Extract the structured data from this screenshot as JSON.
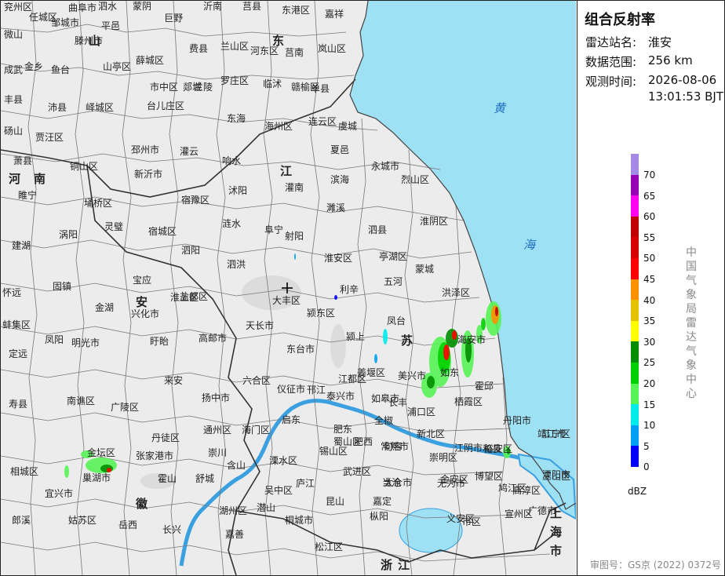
{
  "panel": {
    "title": "组合反射率",
    "station_label": "雷达站名:",
    "station_value": "淮安",
    "range_label": "数据范围:",
    "range_value": "256 km",
    "time_label": "观测时间:",
    "time_value_date": "2026-08-06",
    "time_value_time": "13:01:53 BJT",
    "unit": "dBZ",
    "agency": "中国气象局雷达气象中心",
    "approval": "审图号：GS京 (2022) 0372号"
  },
  "legend": {
    "ticks": [
      "70",
      "65",
      "60",
      "55",
      "50",
      "45",
      "40",
      "35",
      "30",
      "25",
      "20",
      "15",
      "10",
      "5",
      "0"
    ],
    "colors": [
      "#a48ae6",
      "#9500b4",
      "#ff00f0",
      "#c00000",
      "#d60000",
      "#ff0000",
      "#ff9000",
      "#e7c000",
      "#ffff00",
      "#008e00",
      "#00d000",
      "#56f456",
      "#00ecec",
      "#00a0f6",
      "#0000f6"
    ]
  },
  "map": {
    "colors": {
      "sea": "#9ee0f4",
      "land": "#ececec",
      "border": "#555555",
      "river": "#3aa0e0"
    },
    "provinces": [
      "山",
      "东",
      "河",
      "南",
      "安",
      "徽",
      "江",
      "苏",
      "浙",
      "江",
      "上",
      "海",
      "市"
    ],
    "seas": [
      "黄",
      "海"
    ],
    "places": [
      "兖州区",
      "曲阜市",
      "泗水",
      "蒙阴",
      "沂南",
      "莒县",
      "东港区",
      "嘉祥",
      "任城区",
      "邹城市",
      "平邑",
      "巨野",
      "微山",
      "滕州市",
      "费县",
      "兰山区",
      "河东区",
      "莒南",
      "岚山区",
      "成武",
      "金乡",
      "鱼台",
      "山亭区",
      "薛城区",
      "市中区",
      "兰陵",
      "罗庄区",
      "临沭",
      "赣榆区",
      "单县",
      "丰县",
      "沛县",
      "峄城区",
      "台儿庄区",
      "郯城",
      "东海",
      "海州区",
      "连云区",
      "虞城",
      "砀山",
      "贾汪区",
      "邳州市",
      "灌云",
      "夏邑",
      "萧县",
      "铜山区",
      "新沂市",
      "响水",
      "永城市",
      "睢宁",
      "宿豫区",
      "沭阳",
      "灌南",
      "滨海",
      "烈山区",
      "埇桥区",
      "灵璧",
      "宿城区",
      "泗阳",
      "涟水",
      "阜宁",
      "射阳",
      "濉溪",
      "泗县",
      "淮阴区",
      "建湖",
      "涡阳",
      "泗洪",
      "淮安区",
      "亭湖区",
      "蒙城",
      "固镇",
      "宝应",
      "盐都区",
      "大丰区",
      "利辛",
      "五河",
      "洪泽区",
      "怀远",
      "淮上区",
      "金湖",
      "兴化市",
      "颍东区",
      "凤台",
      "蚌集区",
      "凤阳",
      "明光市",
      "盱眙",
      "高邮市",
      "天长市",
      "东台市",
      "颍上",
      "海安市",
      "定远",
      "来安",
      "六合区",
      "仪征市",
      "邗江",
      "江都区",
      "姜堰区",
      "美兴市",
      "如东",
      "霍邱",
      "寿县",
      "南谯区",
      "广陵区",
      "扬中市",
      "泰兴市",
      "如皋市",
      "长丰",
      "浦口区",
      "栖霞区",
      "丹徒区",
      "通州区",
      "海门区",
      "启东",
      "肥东",
      "全椒",
      "丹阳市",
      "靖江市",
      "张家港市",
      "崇川",
      "蜀山区",
      "肥西",
      "句容",
      "新北区",
      "江阴市",
      "和县",
      "江宁区",
      "金坛区",
      "锡山区",
      "常熟市",
      "崇明区",
      "裕安区",
      "巢湖市",
      "含山",
      "溧水区",
      "武进区",
      "太仓市",
      "金安区",
      "博望区",
      "溧阳市",
      "相城区",
      "霍山",
      "舒城",
      "庐江",
      "当涂",
      "高淳区",
      "宜兴市",
      "吴中区",
      "昆山",
      "嘉定",
      "无为市",
      "鸠江区",
      "三山区",
      "郎溪",
      "姑苏区",
      "岳西",
      "潜山",
      "桐城市",
      "枞阳",
      "义安区",
      "宣州区",
      "广德市",
      "长兴",
      "湖州区",
      "嘉善",
      "松江区",
      "市区"
    ],
    "center_mark": "+"
  }
}
